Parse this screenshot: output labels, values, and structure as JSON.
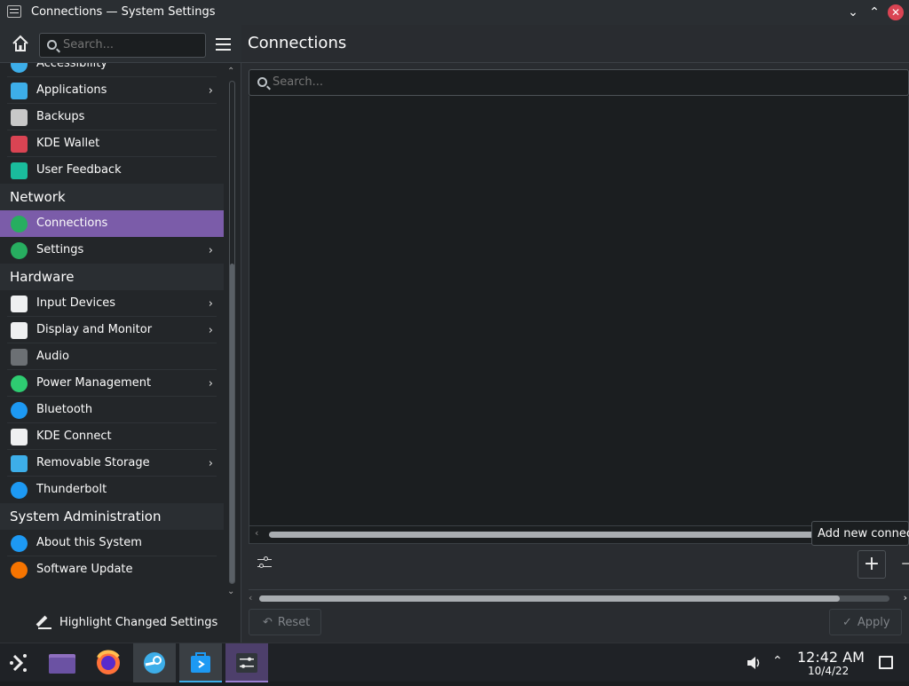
{
  "window": {
    "title": "Connections — System Settings",
    "minimize_icon": "chevron-down-icon",
    "maximize_icon": "chevron-up-icon",
    "close_icon": "close-icon"
  },
  "sidebar": {
    "search_placeholder": "Search...",
    "entries": [
      {
        "kind": "item",
        "label": "Accessibility",
        "icon": "accessibility-icon",
        "color": "#3daee9",
        "chevron": false
      },
      {
        "kind": "item",
        "label": "Applications",
        "icon": "applications-icon",
        "color": "#3daee9",
        "chevron": true
      },
      {
        "kind": "item",
        "label": "Backups",
        "icon": "backups-icon",
        "color": "#c8c8c8",
        "chevron": false
      },
      {
        "kind": "item",
        "label": "KDE Wallet",
        "icon": "wallet-icon",
        "color": "#da4453",
        "chevron": false
      },
      {
        "kind": "item",
        "label": "User Feedback",
        "icon": "user-feedback-icon",
        "color": "#1abc9c",
        "chevron": false
      },
      {
        "kind": "section",
        "label": "Network"
      },
      {
        "kind": "item",
        "label": "Connections",
        "icon": "globe-icon",
        "color": "#27ae60",
        "chevron": false,
        "selected": true
      },
      {
        "kind": "item",
        "label": "Settings",
        "icon": "globe-icon",
        "color": "#27ae60",
        "chevron": true
      },
      {
        "kind": "section",
        "label": "Hardware"
      },
      {
        "kind": "item",
        "label": "Input Devices",
        "icon": "mouse-icon",
        "color": "#eff0f1",
        "chevron": true
      },
      {
        "kind": "item",
        "label": "Display and Monitor",
        "icon": "monitor-icon",
        "color": "#eff0f1",
        "chevron": true
      },
      {
        "kind": "item",
        "label": "Audio",
        "icon": "speaker-icon",
        "color": "#6c7074",
        "chevron": false
      },
      {
        "kind": "item",
        "label": "Power Management",
        "icon": "power-icon",
        "color": "#2ecc71",
        "chevron": true
      },
      {
        "kind": "item",
        "label": "Bluetooth",
        "icon": "bluetooth-icon",
        "color": "#1d99f3",
        "chevron": false
      },
      {
        "kind": "item",
        "label": "KDE Connect",
        "icon": "phone-icon",
        "color": "#eff0f1",
        "chevron": false
      },
      {
        "kind": "item",
        "label": "Removable Storage",
        "icon": "usb-icon",
        "color": "#3daee9",
        "chevron": true
      },
      {
        "kind": "item",
        "label": "Thunderbolt",
        "icon": "thunderbolt-icon",
        "color": "#1d99f3",
        "chevron": false
      },
      {
        "kind": "section",
        "label": "System Administration"
      },
      {
        "kind": "item",
        "label": "About this System",
        "icon": "info-icon",
        "color": "#1d99f3",
        "chevron": false
      },
      {
        "kind": "item",
        "label": "Software Update",
        "icon": "update-icon",
        "color": "#f67400",
        "chevron": false
      }
    ],
    "highlight_label": "Highlight Changed Settings"
  },
  "main": {
    "title": "Connections",
    "search_placeholder": "Search...",
    "tooltip": "Add new connect",
    "add_label": "+",
    "remove_label": "−",
    "reset_label": "Reset",
    "apply_label": "Apply"
  },
  "taskbar": {
    "tasks": [
      {
        "name": "application-launcher",
        "icon": "launcher-icon"
      },
      {
        "name": "file-manager",
        "icon": "folder-icon"
      },
      {
        "name": "firefox",
        "icon": "firefox-icon"
      },
      {
        "name": "steam",
        "icon": "steam-icon"
      },
      {
        "name": "discover",
        "icon": "store-icon"
      },
      {
        "name": "system-settings",
        "icon": "settings-icon"
      }
    ],
    "time": "12:42 AM",
    "date": "10/4/22"
  },
  "colors": {
    "accent": "#7b5ca9",
    "window_bg": "#292c30",
    "view_bg": "#1b1e20"
  }
}
